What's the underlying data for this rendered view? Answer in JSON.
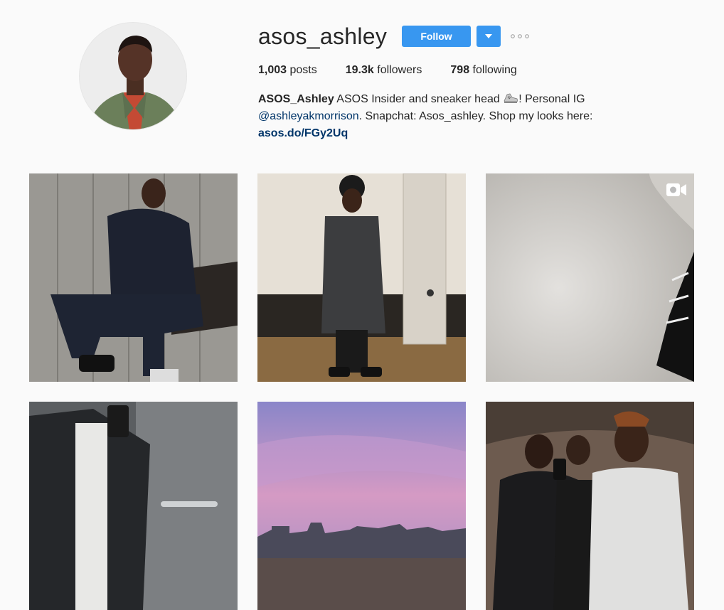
{
  "profile": {
    "username": "asos_ashley",
    "follow_label": "Follow",
    "stats": {
      "posts_count": "1,003",
      "posts_label": "posts",
      "followers_count": "19.3k",
      "followers_label": "followers",
      "following_count": "798",
      "following_label": "following"
    },
    "bio": {
      "full_name": "ASOS_Ashley",
      "text_1": "ASOS Insider and sneaker head",
      "emoji_icon": "sneaker-emoji",
      "text_2": "! Personal IG",
      "mention": "@ashleyakmorrison",
      "text_3": ". Snapchat: Asos_ashley. Shop my looks here:",
      "link": "asos.do/FGy2Uq"
    }
  },
  "colors": {
    "accent": "#3897f0",
    "link": "#003569",
    "background": "#fafafa"
  },
  "posts": [
    {
      "type": "photo",
      "subject": "man-in-navy-hoodie-seated"
    },
    {
      "type": "photo",
      "subject": "mirror-selfie-grey-coat"
    },
    {
      "type": "video",
      "subject": "sneaker-closeup",
      "badge_icon": "video-camera-icon"
    },
    {
      "type": "photo",
      "subject": "elevator-selfie"
    },
    {
      "type": "photo",
      "subject": "pink-sunset-skyline"
    },
    {
      "type": "photo",
      "subject": "group-selfie"
    }
  ]
}
